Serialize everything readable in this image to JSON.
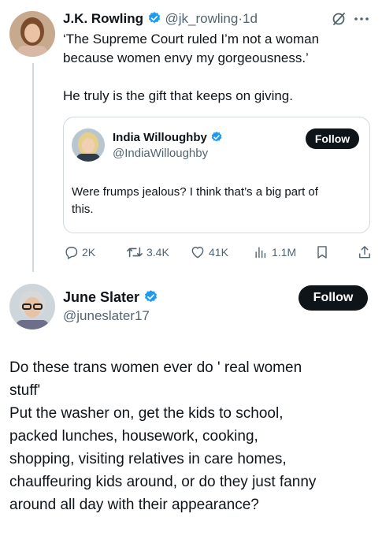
{
  "tweet": {
    "author_name": "J.K. Rowling",
    "handle": "@jk_rowling",
    "separator": "·",
    "time": "1d",
    "text_line1": "‘The Supreme Court ruled I’m not a woman",
    "text_line2": "because women envy my gorgeousness.’",
    "text_line3": "He truly is the gift that keeps on giving."
  },
  "quote": {
    "author_name": "India Willoughby",
    "handle": "@IndiaWilloughby",
    "follow_label": "Follow",
    "text_line1": "Were frumps jealous? I think that’s a big part of",
    "text_line2": "this."
  },
  "actions": {
    "replies": "2K",
    "retweets": "3.4K",
    "likes": "41K",
    "views": "1.1M"
  },
  "reply": {
    "author_name": "June Slater",
    "handle": "@juneslater17",
    "follow_label": "Follow",
    "text_lines": [
      "Do these trans women ever do ' real women",
      "stuff'",
      "Put the washer on, get the kids to school,",
      "packed lunches,  housework, cooking,",
      "shopping, visiting relatives in care homes,",
      "chauffeuring kids around, or do they just fanny",
      "around all day with their appearance?"
    ]
  },
  "colors": {
    "verified": "#1d9bf0",
    "muted": "#536471",
    "button": "#0f1419",
    "border": "#cfd9de"
  },
  "icons": [
    "verified-badge-icon",
    "grok-icon",
    "more-icon",
    "reply-icon",
    "retweet-icon",
    "like-icon",
    "views-icon",
    "bookmark-icon",
    "share-icon"
  ]
}
